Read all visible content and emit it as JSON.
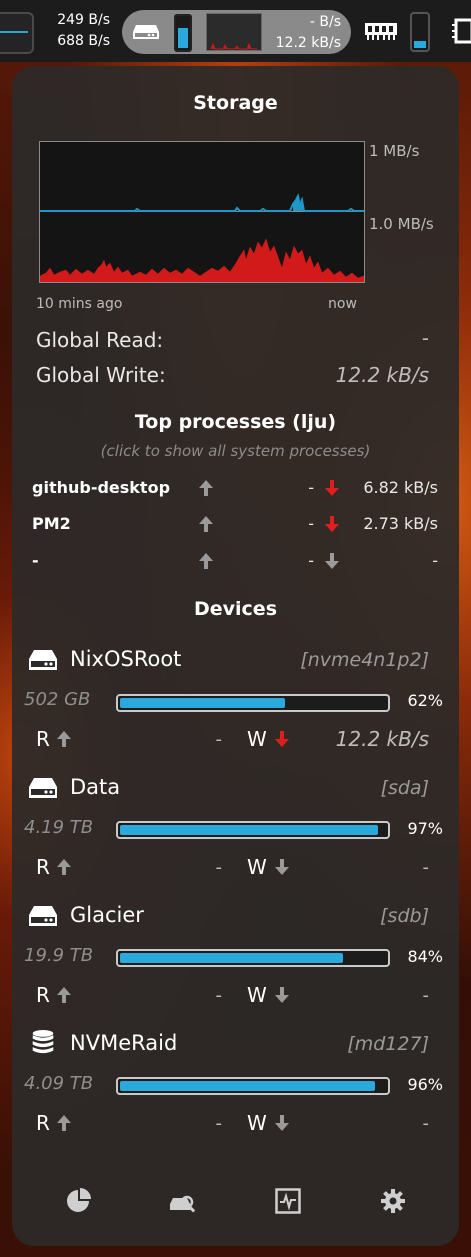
{
  "topbar": {
    "net_down": "249 B/s",
    "net_up": "688 B/s",
    "disk_read": "- B/s",
    "disk_write": "12.2 kB/s",
    "icons": [
      "network-graph-icon",
      "drive-icon",
      "disk-usage-meter-icon",
      "io-graph-icon",
      "ram-icon",
      "memory-meter-icon",
      "cpu-chip-icon"
    ]
  },
  "storage": {
    "title": "Storage",
    "graph": {
      "top_label": "1 MB/s",
      "mid_label": "1.0 MB/s",
      "x_start": "10 mins ago",
      "x_end": "now",
      "read_color": "#1e98c8",
      "write_color": "#d21a1a"
    },
    "global_read_label": "Global Read:",
    "global_read_value": "-",
    "global_write_label": "Global Write:",
    "global_write_value": "12.2 kB/s"
  },
  "processes": {
    "title": "Top processes (lju)",
    "hint": "(click to show all system processes)",
    "rows": [
      {
        "name": "github-desktop",
        "read": "-",
        "write": "6.82 kB/s",
        "write_active": true
      },
      {
        "name": "PM2",
        "read": "-",
        "write": "2.73 kB/s",
        "write_active": true
      },
      {
        "name": "-",
        "read": "-",
        "write": "-",
        "write_active": false
      }
    ]
  },
  "devices": {
    "title": "Devices",
    "items": [
      {
        "name": "NixOSRoot",
        "id": "[nvme4n1p2]",
        "size": "502 GB",
        "usage": 0.62,
        "pct": "62%",
        "r_label": "R",
        "read": "-",
        "w_label": "W",
        "write": "12.2 kB/s",
        "write_active": true,
        "icon": "drive-icon"
      },
      {
        "name": "Data",
        "id": "[sda]",
        "size": "4.19 TB",
        "usage": 0.97,
        "pct": "97%",
        "r_label": "R",
        "read": "-",
        "w_label": "W",
        "write": "-",
        "write_active": false,
        "icon": "drive-icon"
      },
      {
        "name": "Glacier",
        "id": "[sdb]",
        "size": "19.9 TB",
        "usage": 0.84,
        "pct": "84%",
        "r_label": "R",
        "read": "-",
        "w_label": "W",
        "write": "-",
        "write_active": false,
        "icon": "drive-icon"
      },
      {
        "name": "NVMeRaid",
        "id": "[md127]",
        "size": "4.09 TB",
        "usage": 0.96,
        "pct": "96%",
        "r_label": "R",
        "read": "-",
        "w_label": "W",
        "write": "-",
        "write_active": false,
        "icon": "database-icon"
      }
    ]
  },
  "footer": {
    "icons": [
      "pie-chart-icon",
      "disk-search-icon",
      "system-monitor-icon",
      "settings-gear-icon"
    ]
  }
}
